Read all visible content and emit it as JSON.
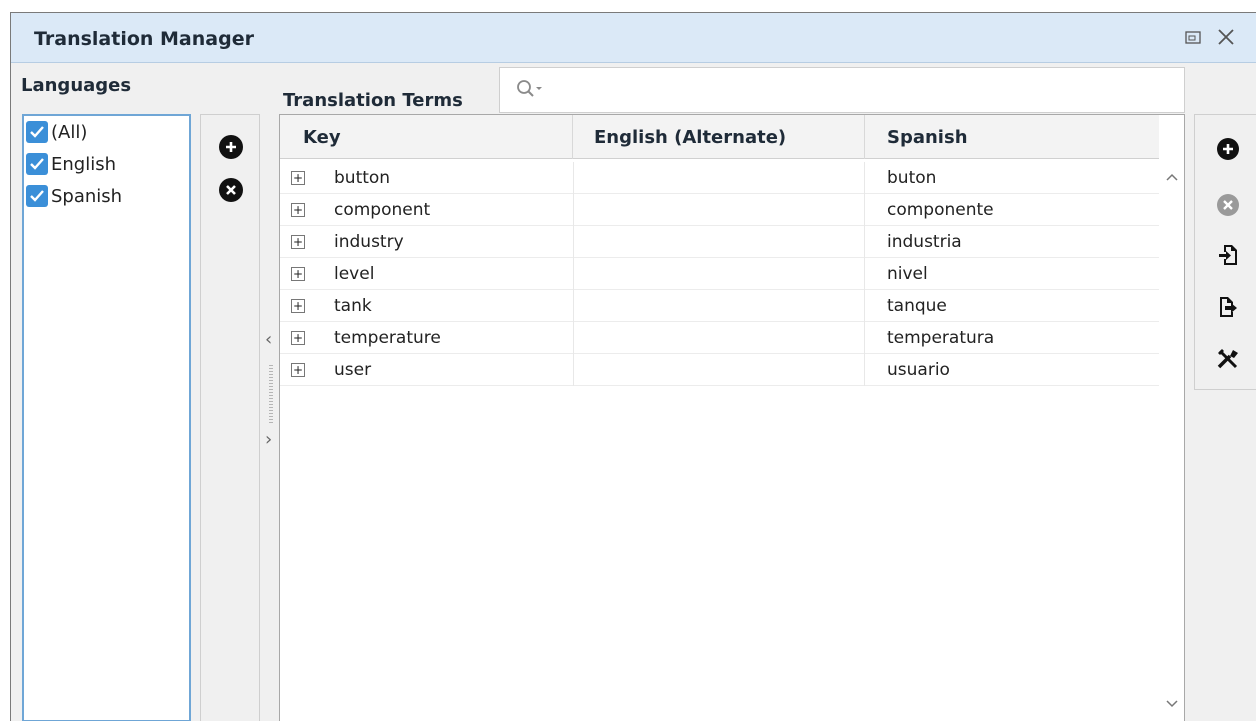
{
  "window": {
    "title": "Translation Manager"
  },
  "languages": {
    "title": "Languages",
    "items": [
      {
        "label": "(All)",
        "checked": true
      },
      {
        "label": "English",
        "checked": true
      },
      {
        "label": "Spanish",
        "checked": true
      }
    ]
  },
  "terms": {
    "title": "Translation Terms",
    "search_value": "",
    "columns": [
      "Key",
      "English (Alternate)",
      "Spanish"
    ],
    "rows": [
      {
        "key": "button",
        "english": "",
        "spanish": "buton"
      },
      {
        "key": "component",
        "english": "",
        "spanish": "componente"
      },
      {
        "key": "industry",
        "english": "",
        "spanish": "industria"
      },
      {
        "key": "level",
        "english": "",
        "spanish": "nivel"
      },
      {
        "key": "tank",
        "english": "",
        "spanish": "tanque"
      },
      {
        "key": "temperature",
        "english": "",
        "spanish": "temperatura"
      },
      {
        "key": "user",
        "english": "",
        "spanish": "usuario"
      }
    ]
  },
  "icons": {
    "restore": "restore-window-icon",
    "close": "close-icon",
    "search": "search-icon",
    "add_language": "add-circle-icon",
    "remove_language": "remove-circle-icon",
    "add_term": "add-circle-icon",
    "remove_term": "remove-circle-icon",
    "import": "import-icon",
    "export": "export-icon",
    "tools": "tools-icon"
  },
  "colors": {
    "titlebar": "#dbe9f7",
    "accent": "#3b8fd8",
    "list_border": "#6fa6d6"
  }
}
